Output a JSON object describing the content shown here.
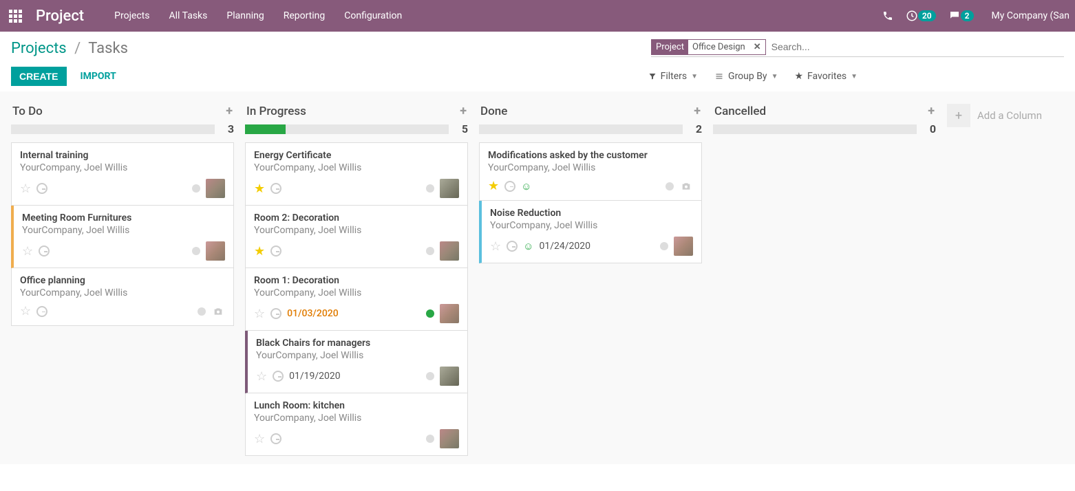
{
  "nav": {
    "app": "Project",
    "links": [
      "Projects",
      "All Tasks",
      "Planning",
      "Reporting",
      "Configuration"
    ],
    "timer_badge": "20",
    "chat_badge": "2",
    "company": "My Company (San "
  },
  "breadcrumb": {
    "link": "Projects",
    "sep": "/",
    "current": "Tasks"
  },
  "search": {
    "facet_label": "Project",
    "facet_value": "Office Design",
    "placeholder": "Search..."
  },
  "buttons": {
    "create": "CREATE",
    "import": "IMPORT"
  },
  "filters": {
    "filters": "Filters",
    "groupby": "Group By",
    "favorites": "Favorites"
  },
  "columns": [
    {
      "title": "To Do",
      "count": "3",
      "progress": 0,
      "cards": [
        {
          "title": "Internal training",
          "sub": "YourCompany, Joel Willis",
          "star": false,
          "stripe": "",
          "avatar": "a1"
        },
        {
          "title": "Meeting Room Furnitures",
          "sub": "YourCompany, Joel Willis",
          "star": false,
          "stripe": "left-yellow",
          "avatar": "a2"
        },
        {
          "title": "Office planning",
          "sub": "YourCompany, Joel Willis",
          "star": false,
          "stripe": "",
          "cam": true
        }
      ]
    },
    {
      "title": "In Progress",
      "count": "5",
      "progress": 20,
      "cards": [
        {
          "title": "Energy Certificate",
          "sub": "YourCompany, Joel Willis",
          "star": true,
          "avatar": "a3"
        },
        {
          "title": "Room 2: Decoration",
          "sub": "YourCompany, Joel Willis",
          "star": true,
          "avatar": "a1"
        },
        {
          "title": "Room 1: Decoration",
          "sub": "YourCompany, Joel Willis",
          "star": false,
          "date": "01/03/2020",
          "date_color": "orange",
          "dot": "green",
          "avatar": "a2"
        },
        {
          "title": "Black Chairs for managers",
          "sub": "YourCompany, Joel Willis",
          "star": false,
          "date": "01/19/2020",
          "stripe": "left-purple",
          "avatar": "a3"
        },
        {
          "title": "Lunch Room: kitchen",
          "sub": "YourCompany, Joel Willis",
          "star": false,
          "avatar": "a1"
        }
      ]
    },
    {
      "title": "Done",
      "count": "2",
      "progress": 0,
      "cards": [
        {
          "title": "Modifications asked by the customer",
          "sub": "YourCompany, Joel Willis",
          "star": true,
          "smiley": true,
          "cam": true
        },
        {
          "title": "Noise Reduction",
          "sub": "YourCompany, Joel Willis",
          "star": false,
          "smiley": true,
          "date": "01/24/2020",
          "stripe": "left-blue",
          "avatar": "a2"
        }
      ]
    },
    {
      "title": "Cancelled",
      "count": "0",
      "progress": 0,
      "cards": []
    }
  ],
  "add_column": "Add a Column"
}
